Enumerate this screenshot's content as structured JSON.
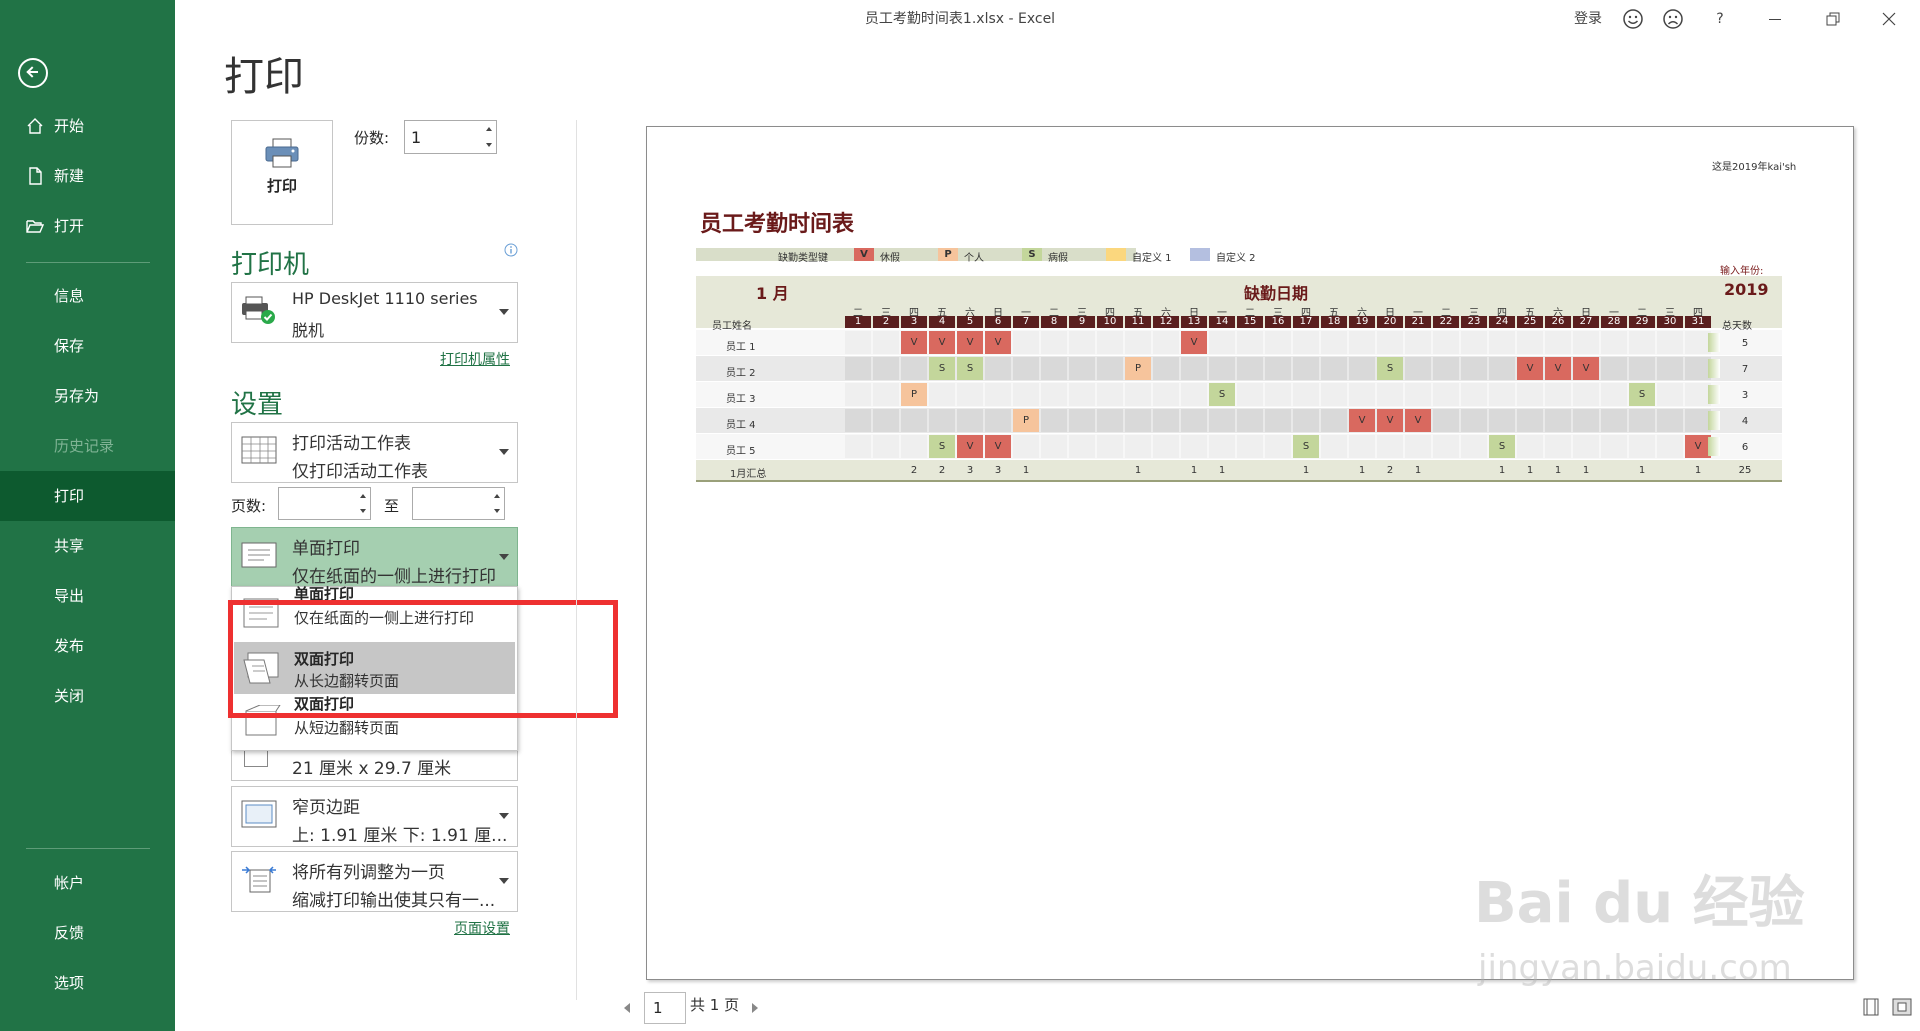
{
  "window": {
    "title": "员工考勤时间表1.xlsx  -  Excel",
    "signin": "登录",
    "help": "?",
    "smile_icon": "smile-icon",
    "frown_icon": "frown-icon"
  },
  "sidebar": {
    "back_icon": "back-arrow-icon",
    "items": [
      {
        "label": "开始",
        "icon": "home-icon"
      },
      {
        "label": "新建",
        "icon": "new-file-icon"
      },
      {
        "label": "打开",
        "icon": "folder-open-icon"
      },
      {
        "label": "信息"
      },
      {
        "label": "保存"
      },
      {
        "label": "另存为"
      },
      {
        "label": "历史记录",
        "disabled": true
      },
      {
        "label": "打印",
        "active": true
      },
      {
        "label": "共享"
      },
      {
        "label": "导出"
      },
      {
        "label": "发布"
      },
      {
        "label": "关闭"
      },
      {
        "label": "帐户"
      },
      {
        "label": "反馈"
      },
      {
        "label": "选项"
      }
    ]
  },
  "print": {
    "heading": "打印",
    "print_button": "打印",
    "copies_label": "份数:",
    "copies_value": "1",
    "printer_heading": "打印机",
    "printer_name": "HP DeskJet 1110 series",
    "printer_status": "脱机",
    "printer_properties": "打印机属性",
    "settings_heading": "设置",
    "scope_title": "打印活动工作表",
    "scope_sub": "仅打印活动工作表",
    "pages_label": "页数:",
    "to_label": "至",
    "sides_title": "单面打印",
    "sides_sub": "仅在纸面的一侧上进行打印",
    "paper_size": "21 厘米 x 29.7 厘米",
    "margins_title": "窄页边距",
    "margins_sub": "上: 1.91 厘米 下: 1.91 厘...",
    "scale_title": "将所有列调整为一页",
    "scale_sub": "缩减打印输出使其只有一...",
    "page_setup": "页面设置",
    "popup": [
      {
        "title": "单面打印",
        "sub": "仅在纸面的一侧上进行打印"
      },
      {
        "title": "双面打印",
        "sub": "从长边翻转页面",
        "selected": true
      },
      {
        "title": "双面打印",
        "sub": "从短边翻转页面"
      }
    ],
    "page_nav_value": "1",
    "page_nav_total": "共 1 页"
  },
  "preview": {
    "header_note": "这是2019年kai'sh",
    "title": "员工考勤时间表",
    "legend_label": "缺勤类型键",
    "legend": [
      {
        "code": "V",
        "label": "休假",
        "color": "#d9695f"
      },
      {
        "code": "P",
        "label": "个人",
        "color": "#f6c49c"
      },
      {
        "code": "S",
        "label": "病假",
        "color": "#c3d69b"
      },
      {
        "code": "",
        "label": "自定义 1",
        "color": "#fbd77e"
      },
      {
        "code": "",
        "label": "自定义 2",
        "color": "#b4bfe0"
      }
    ],
    "year_input_label": "输入年份:",
    "month": "1 月",
    "absence_date_label": "缺勤日期",
    "year": "2019",
    "name_header": "员工姓名",
    "total_header": "总天数",
    "weekdays": [
      "二",
      "三",
      "四",
      "五",
      "六",
      "日",
      "一",
      "二",
      "三",
      "四",
      "五",
      "六",
      "日",
      "一",
      "二",
      "三",
      "四",
      "五",
      "六",
      "日",
      "一",
      "二",
      "三",
      "四",
      "五",
      "六",
      "日",
      "一",
      "二",
      "三",
      "四"
    ],
    "days": [
      "1",
      "2",
      "3",
      "4",
      "5",
      "6",
      "7",
      "8",
      "9",
      "10",
      "11",
      "12",
      "13",
      "14",
      "15",
      "16",
      "17",
      "18",
      "19",
      "20",
      "21",
      "22",
      "23",
      "24",
      "25",
      "26",
      "27",
      "28",
      "29",
      "30",
      "31"
    ],
    "employees": [
      {
        "name": "员工 1",
        "marks": {
          "3": "V",
          "4": "V",
          "5": "V",
          "6": "V",
          "13": "V"
        },
        "total": "5"
      },
      {
        "name": "员工 2",
        "marks": {
          "4": "S",
          "5": "S",
          "11": "P",
          "20": "S",
          "25": "V",
          "26": "V",
          "27": "V"
        },
        "total": "7"
      },
      {
        "name": "员工 3",
        "marks": {
          "3": "P",
          "14": "S",
          "29": "S"
        },
        "total": "3"
      },
      {
        "name": "员工 4",
        "marks": {
          "7": "P",
          "19": "V",
          "20": "V",
          "21": "V"
        },
        "total": "4"
      },
      {
        "name": "员工 5",
        "marks": {
          "4": "S",
          "5": "V",
          "6": "V",
          "17": "S",
          "24": "S",
          "31": "V"
        },
        "total": "6"
      }
    ],
    "summary_label": "1月汇总",
    "summary": {
      "3": "2",
      "4": "2",
      "5": "3",
      "6": "3",
      "7": "1",
      "11": "1",
      "13": "1",
      "14": "1",
      "17": "1",
      "19": "1",
      "20": "2",
      "21": "1",
      "24": "1",
      "25": "1",
      "26": "1",
      "27": "1",
      "29": "1",
      "31": "1"
    },
    "summary_total": "25"
  },
  "watermark": {
    "brand": "Bai du 经验",
    "url": "jingyan.baidu.com"
  }
}
